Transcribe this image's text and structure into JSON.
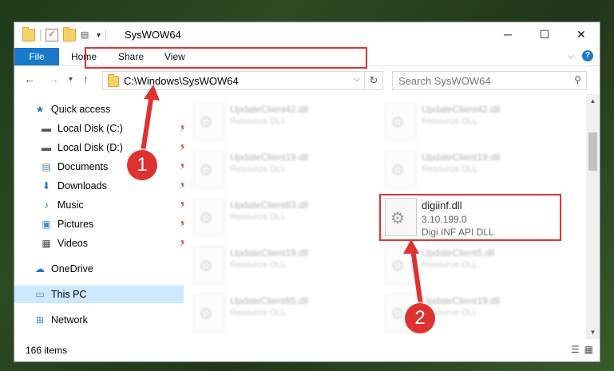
{
  "window": {
    "title": "SysWOW64",
    "controls": {
      "minimize": "─",
      "maximize": "☐",
      "close": "✕"
    }
  },
  "ribbon": {
    "file_tab": "File",
    "tabs": [
      "Home",
      "Share",
      "View"
    ],
    "help": "?"
  },
  "nav": {
    "back": "←",
    "forward": "→",
    "recent": "▾",
    "up": "↑",
    "address": "C:\\Windows\\SysWOW64",
    "address_dropdown": "⌵",
    "refresh": "↻",
    "search_placeholder": "Search SysWOW64",
    "search_icon": "⚲"
  },
  "sidebar": {
    "quick_access": "Quick access",
    "items": [
      {
        "label": "Local Disk (C:)",
        "icon": "drive-icon"
      },
      {
        "label": "Local Disk (D:)",
        "icon": "drive-icon"
      },
      {
        "label": "Documents",
        "icon": "documents-icon"
      },
      {
        "label": "Downloads",
        "icon": "downloads-icon"
      },
      {
        "label": "Music",
        "icon": "music-icon"
      },
      {
        "label": "Pictures",
        "icon": "pictures-icon"
      },
      {
        "label": "Videos",
        "icon": "videos-icon"
      }
    ],
    "onedrive": "OneDrive",
    "this_pc": "This PC",
    "network": "Network"
  },
  "files": {
    "left_column": [
      {
        "name": "UpdateClient42.dll",
        "desc": "Resource DLL"
      },
      {
        "name": "UpdateClient19.dll",
        "desc": "Resource DLL"
      },
      {
        "name": "UpdateClient63.dll",
        "desc": "Resource DLL"
      },
      {
        "name": "UpdateClient19.dll",
        "desc": "Resource DLL"
      },
      {
        "name": "UpdateClient65.dll",
        "desc": "Resource DLL"
      }
    ],
    "right_column": [
      {
        "name": "UpdateClient42.dll",
        "desc": "Resource DLL"
      },
      {
        "name": "UpdateClient19.dll",
        "desc": "Resource DLL"
      },
      {
        "name": "UpdateClient5.dll",
        "desc": "Resource DLL"
      },
      {
        "name": "UpdateClient19.dll",
        "desc": "Resource DLL"
      }
    ],
    "selected": {
      "name": "digiinf.dll",
      "version": "3.10.199.0",
      "desc": "Digi INF API DLL"
    }
  },
  "status": {
    "count": "166 items"
  },
  "callouts": [
    "1",
    "2"
  ],
  "colors": {
    "accent": "#1979ca",
    "highlight": "#e03131"
  }
}
